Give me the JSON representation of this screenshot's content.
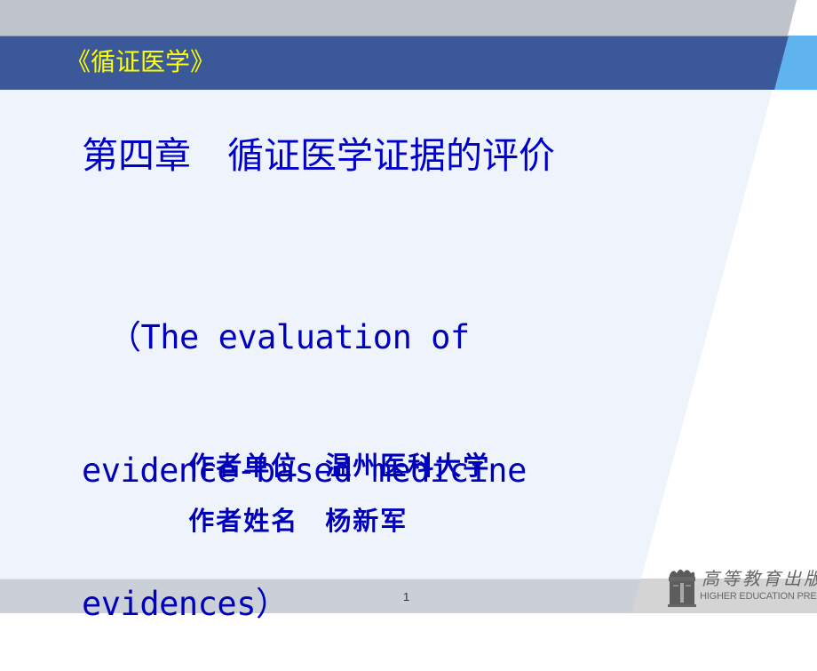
{
  "slide": {
    "header": {
      "title": "《循证医学》"
    },
    "chapter_title": "第四章　循证医学证据的评价",
    "subtitle_lines": [
      "（The evaluation of",
      "evidence-based medicine",
      "evidences）"
    ],
    "author_info": [
      {
        "label": "作者单位",
        "value": "温州医科大学"
      },
      {
        "label": "作者姓名",
        "value": "杨新军"
      }
    ],
    "page_number": "1",
    "publisher": {
      "name_cn": "高等教育出版社",
      "name_en": "HIGHER EDUCATION PRESS",
      "logo_icon": "publisher-logo-icon"
    },
    "colors": {
      "header_band": "#3b5998",
      "header_accent": "#5fb3ee",
      "top_band": "#bfc3ca",
      "body_panel": "#eff4fc",
      "footer_band": "#cbd0d8",
      "title_text": "#ffff00",
      "body_text": "#0000cc"
    }
  }
}
